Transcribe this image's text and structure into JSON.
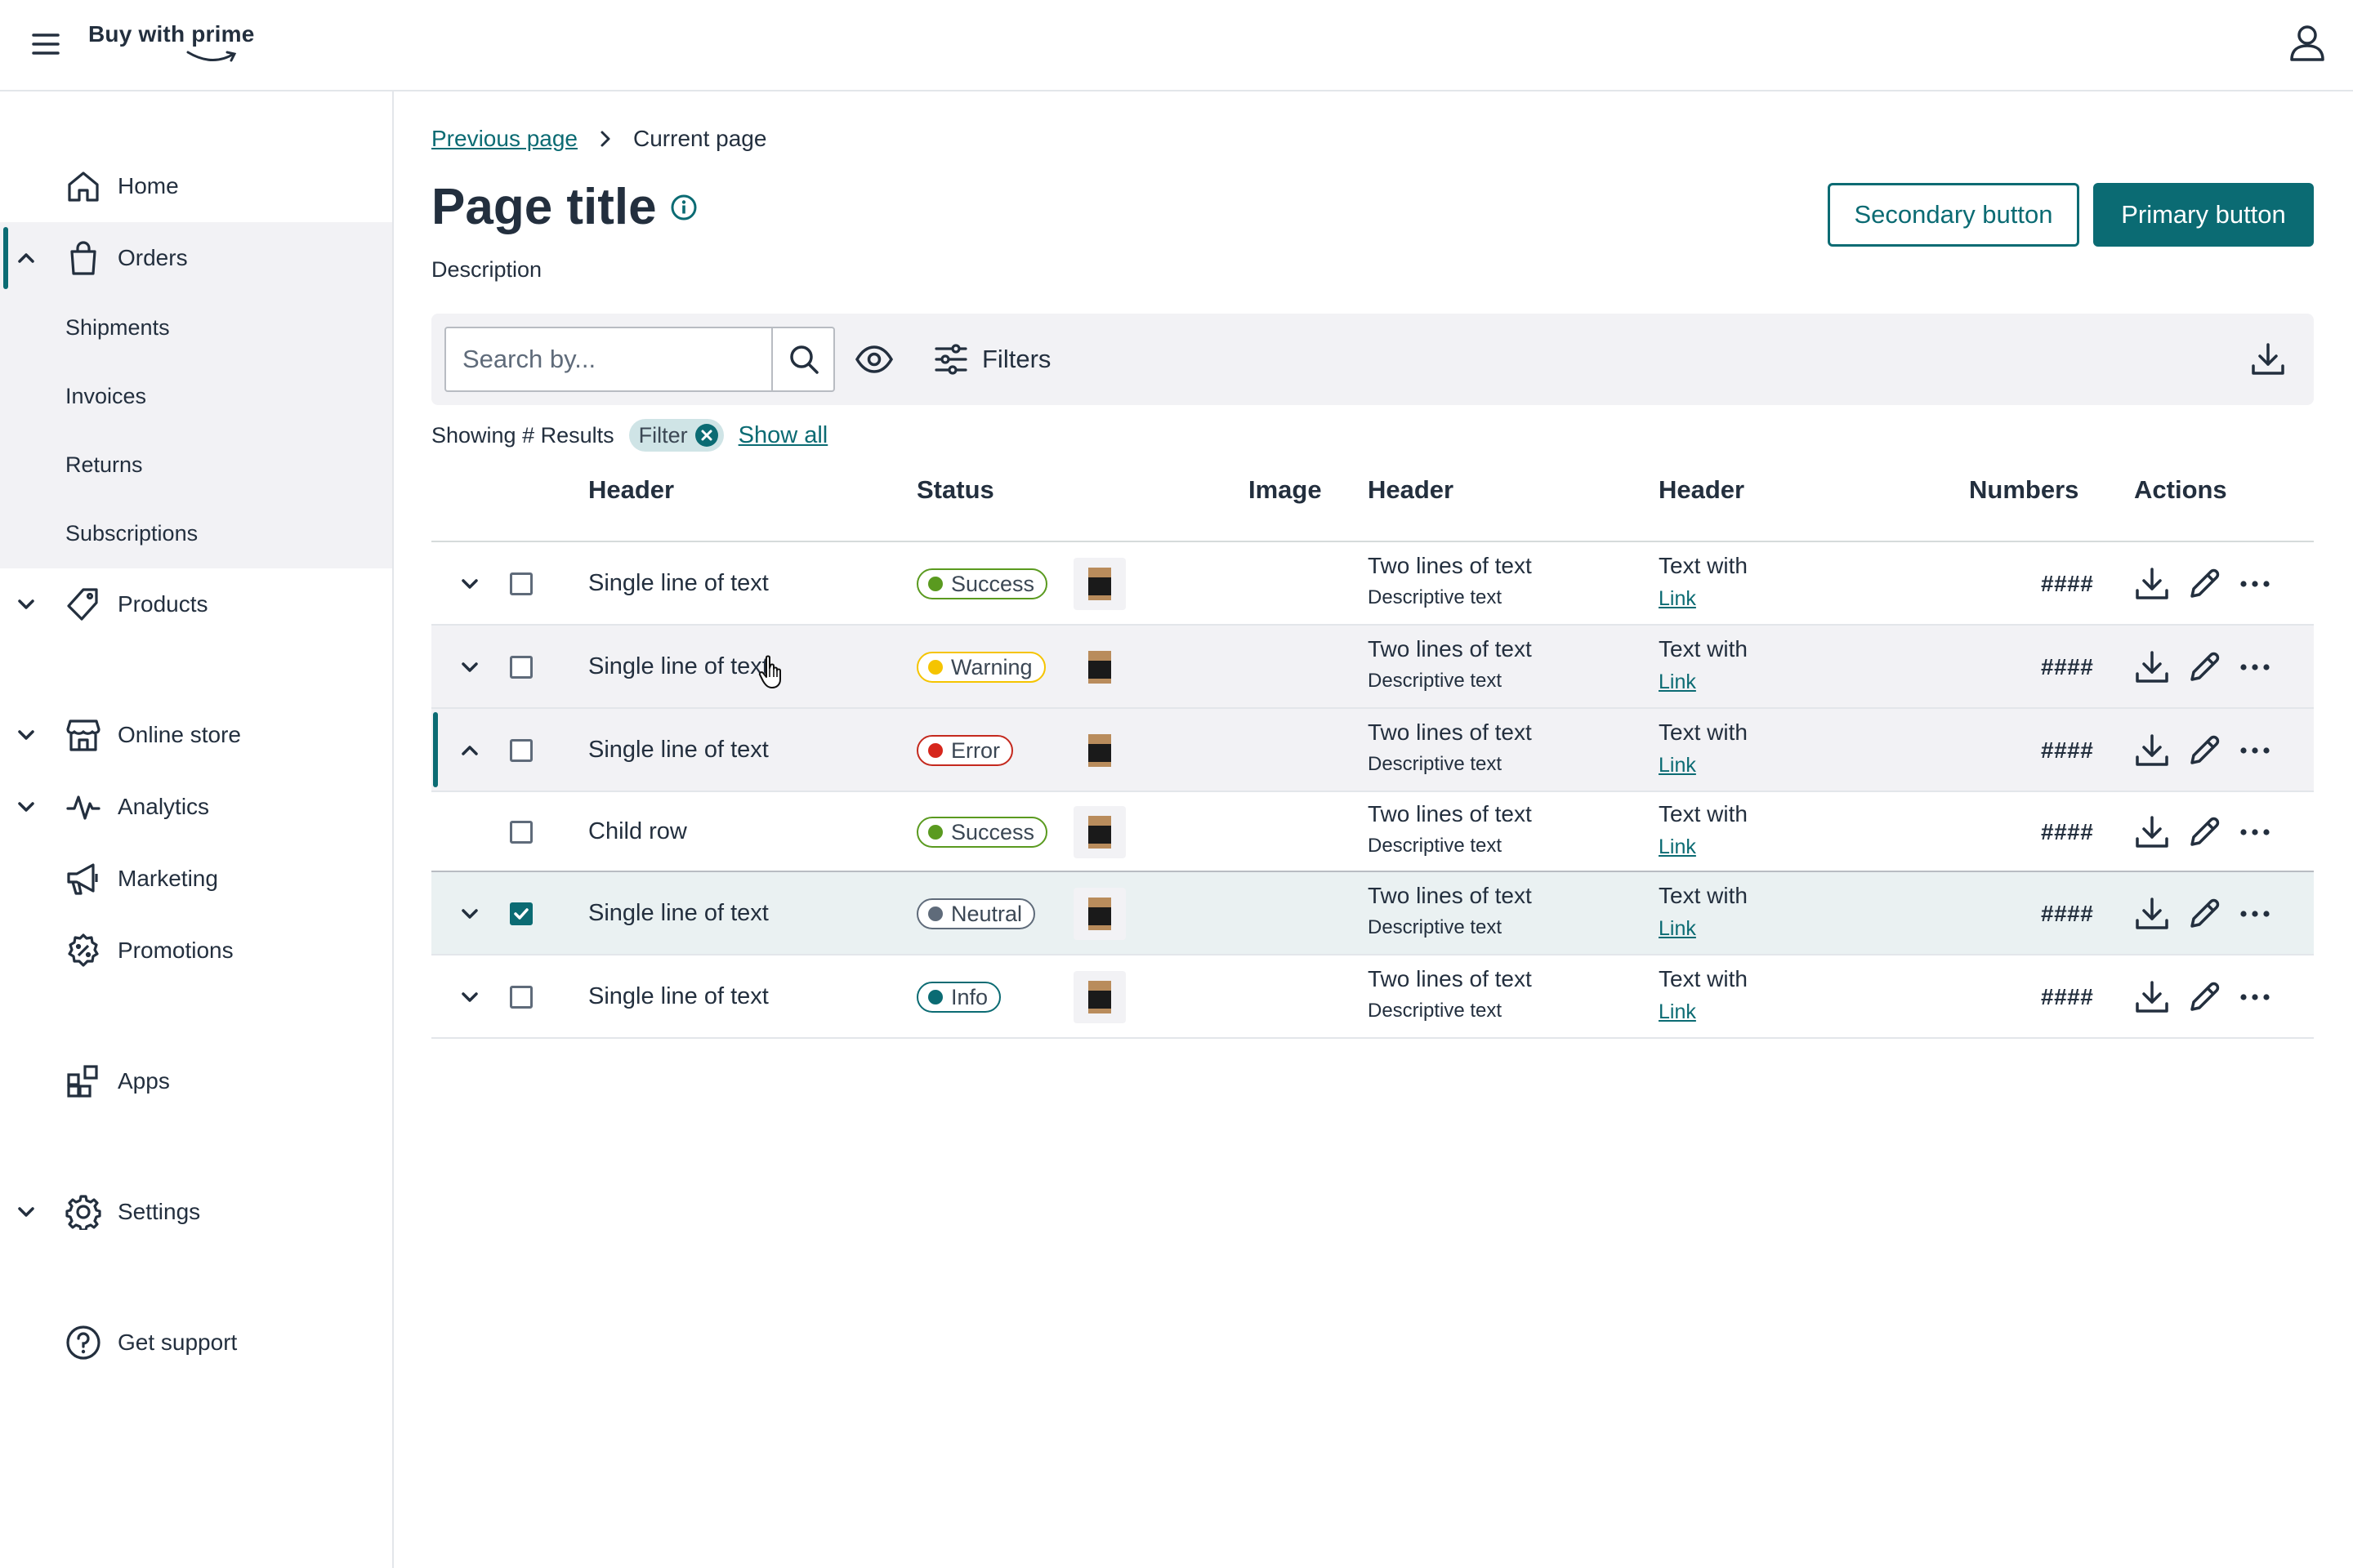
{
  "app": {
    "logo_text": "Buy with prime"
  },
  "sidebar": {
    "items": [
      {
        "label": "Home"
      },
      {
        "label": "Orders"
      },
      {
        "label": "Products"
      },
      {
        "label": "Online store"
      },
      {
        "label": "Analytics"
      },
      {
        "label": "Marketing"
      },
      {
        "label": "Promotions"
      },
      {
        "label": "Apps"
      },
      {
        "label": "Settings"
      },
      {
        "label": "Get support"
      }
    ],
    "orders_sub": [
      {
        "label": "Shipments"
      },
      {
        "label": "Invoices"
      },
      {
        "label": "Returns"
      },
      {
        "label": "Subscriptions"
      }
    ]
  },
  "breadcrumb": {
    "previous": "Previous page",
    "current": "Current page"
  },
  "page": {
    "title": "Page title",
    "description": "Description"
  },
  "buttons": {
    "secondary": "Secondary button",
    "primary": "Primary button"
  },
  "toolbar": {
    "search_placeholder": "Search by...",
    "filters_label": "Filters"
  },
  "results": {
    "showing": "Showing # Results",
    "filter_chip": "Filter",
    "show_all": "Show all"
  },
  "table": {
    "headers": [
      "Header",
      "Status",
      "Image",
      "Header",
      "Header",
      "Numbers",
      "Actions"
    ],
    "rows": [
      {
        "text": "Single line of text",
        "status": "Success",
        "two_a": "Two lines of text",
        "two_b": "Descriptive text",
        "tw_a": "Text with",
        "tw_link": "Link",
        "number": "####",
        "checked": false,
        "state": "default"
      },
      {
        "text": "Single line of text",
        "status": "Warning",
        "two_a": "Two lines of text",
        "two_b": "Descriptive text",
        "tw_a": "Text with",
        "tw_link": "Link",
        "number": "####",
        "checked": false,
        "state": "hover"
      },
      {
        "text": "Single line of text",
        "status": "Error",
        "two_a": "Two lines of text",
        "two_b": "Descriptive text",
        "tw_a": "Text with",
        "tw_link": "Link",
        "number": "####",
        "checked": false,
        "state": "expanded"
      },
      {
        "text": "Child row",
        "status": "Success",
        "two_a": "Two lines of text",
        "two_b": "Descriptive text",
        "tw_a": "Text with",
        "tw_link": "Link",
        "number": "####",
        "checked": false,
        "state": "child"
      },
      {
        "text": "Single line of text",
        "status": "Neutral",
        "two_a": "Two lines of text",
        "two_b": "Descriptive text",
        "tw_a": "Text with",
        "tw_link": "Link",
        "number": "####",
        "checked": true,
        "state": "selected"
      },
      {
        "text": "Single line of text",
        "status": "Info",
        "two_a": "Two lines of text",
        "two_b": "Descriptive text",
        "tw_a": "Text with",
        "tw_link": "Link",
        "number": "####",
        "checked": false,
        "state": "default"
      }
    ]
  },
  "status_colors": {
    "Success": {
      "dot": "#5a9a1f",
      "border": "#5a9a1f"
    },
    "Warning": {
      "dot": "#f5c400",
      "border": "#f5c400"
    },
    "Error": {
      "dot": "#d6261c",
      "border": "#c4291e"
    },
    "Neutral": {
      "dot": "#5f6b7a",
      "border": "#5f6b7a"
    },
    "Info": {
      "dot": "#0b6b73",
      "border": "#0b6b73"
    }
  },
  "colors": {
    "accent": "#0b6b73",
    "text": "#232f3e",
    "surface": "#f2f2f5"
  },
  "icons": [
    "menu-icon",
    "user-icon",
    "home-icon",
    "shopping-bag-icon",
    "tag-icon",
    "storefront-icon",
    "analytics-icon",
    "megaphone-icon",
    "promotion-icon",
    "apps-icon",
    "gear-icon",
    "help-icon",
    "search-icon",
    "eye-icon",
    "filter-icon",
    "download-icon",
    "edit-icon",
    "more-icon",
    "info-icon"
  ]
}
